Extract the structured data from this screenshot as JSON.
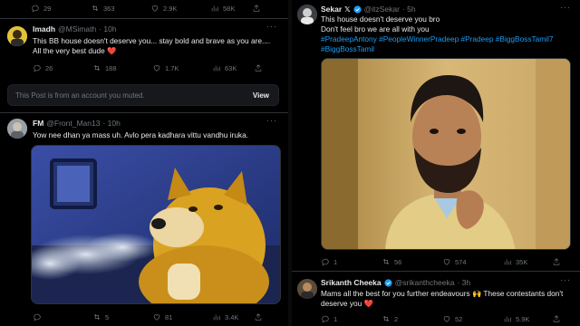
{
  "left_column": {
    "top_actions": {
      "replies": "29",
      "reposts": "363",
      "likes": "2.9K",
      "views": "58K"
    },
    "tweet1": {
      "name": "Imadh",
      "handle": "@MSimath",
      "time": "· 10h",
      "line1": "This BB house doesn't deserve you... stay bold and brave as you are....",
      "line2": "All the very best dude ❤️",
      "actions": {
        "replies": "26",
        "reposts": "188",
        "likes": "1.7K",
        "views": "63K"
      }
    },
    "muted_notice": {
      "text": "This Post is from an account you muted.",
      "button": "View"
    },
    "tweet2": {
      "name": "FM",
      "handle": "@Front_Man13",
      "time": "· 10h",
      "text": "Yow nee dhan ya mass uh. Avlo pera kadhara vittu vandhu iruka.",
      "media_icon": "doge-smoking-meme",
      "actions": {
        "replies": "",
        "reposts": "5",
        "likes": "81",
        "views": "3.4K"
      }
    }
  },
  "right_column": {
    "tweet1": {
      "name": "Sekar",
      "badge": "𝕏",
      "handle": "@itzSekar",
      "time": "· 5h",
      "line1": "This house doesn't deserve you bro",
      "line2": "Don't feel bro we are all with you",
      "hashtags_line1": "#PradeepAntony #PeopleWinnerPradeep #Pradeep #BiggBossTamil7",
      "hashtags_line2": "#BiggBossTamil",
      "media_icon": "bearded-man-photo",
      "actions": {
        "replies": "1",
        "reposts": "56",
        "likes": "574",
        "views": "35K"
      }
    },
    "tweet2": {
      "name": "Srikanth Cheeka",
      "handle": "@srikanthcheeka",
      "time": "· 3h",
      "line1": "Mams all the best for you further endeavours 🙌 These contestants don't",
      "line2": "deserve you ❤️",
      "actions": {
        "replies": "1",
        "reposts": "2",
        "likes": "52",
        "views": "5.9K"
      }
    }
  },
  "colors": {
    "background": "#000000",
    "border": "#2f3336",
    "muted_text": "#71767b",
    "link": "#1d9bf0",
    "verified": "#1d9bf0"
  }
}
